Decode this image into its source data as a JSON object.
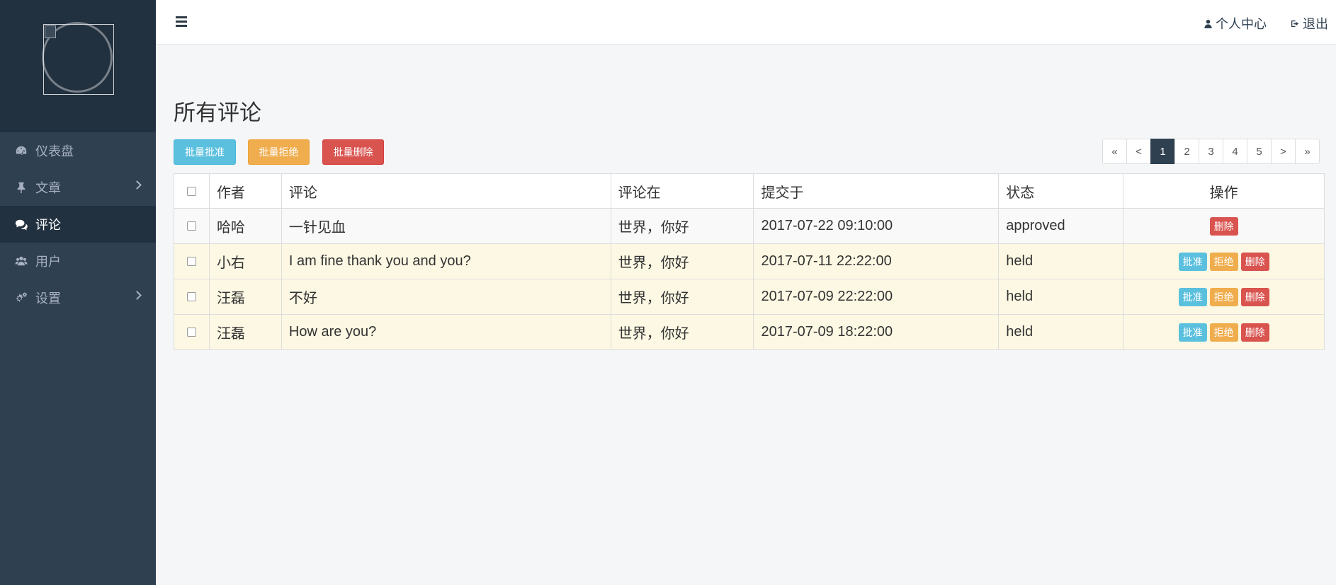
{
  "sidebar": {
    "items": [
      {
        "label": "仪表盘",
        "icon": "dashboard-icon",
        "active": false,
        "has_submenu": false
      },
      {
        "label": "文章",
        "icon": "thumbtack-icon",
        "active": false,
        "has_submenu": true
      },
      {
        "label": "评论",
        "icon": "comments-icon",
        "active": true,
        "has_submenu": false
      },
      {
        "label": "用户",
        "icon": "users-icon",
        "active": false,
        "has_submenu": false
      },
      {
        "label": "设置",
        "icon": "cogs-icon",
        "active": false,
        "has_submenu": true
      }
    ]
  },
  "topbar": {
    "profile_label": "个人中心",
    "logout_label": "退出"
  },
  "page": {
    "title": "所有评论"
  },
  "bulk_actions": {
    "approve": "批量批准",
    "reject": "批量拒绝",
    "delete": "批量删除"
  },
  "pagination": {
    "first": "«",
    "prev": "<",
    "pages": [
      "1",
      "2",
      "3",
      "4",
      "5"
    ],
    "current": "1",
    "next": ">",
    "last": "»"
  },
  "table": {
    "headers": {
      "author": "作者",
      "comment": "评论",
      "post": "评论在",
      "submitted": "提交于",
      "status": "状态",
      "actions": "操作"
    },
    "rows": [
      {
        "author": "哈哈",
        "comment": "一针见血",
        "post": "世界，你好",
        "submitted": "2017-07-22 09:10:00",
        "status": "approved"
      },
      {
        "author": "小右",
        "comment": "I am fine thank you and you?",
        "post": "世界，你好",
        "submitted": "2017-07-11 22:22:00",
        "status": "held"
      },
      {
        "author": "汪磊",
        "comment": "不好",
        "post": "世界，你好",
        "submitted": "2017-07-09 22:22:00",
        "status": "held"
      },
      {
        "author": "汪磊",
        "comment": "How are you?",
        "post": "世界，你好",
        "submitted": "2017-07-09 18:22:00",
        "status": "held"
      }
    ],
    "row_actions": {
      "approve": "批准",
      "reject": "拒绝",
      "delete": "删除"
    }
  },
  "colors": {
    "sidebar_bg": "#2f4050",
    "sidebar_dark": "#22313f",
    "info": "#5bc0de",
    "warning": "#f0ad4e",
    "danger": "#d9534f",
    "held_row": "#fcf8e3"
  }
}
